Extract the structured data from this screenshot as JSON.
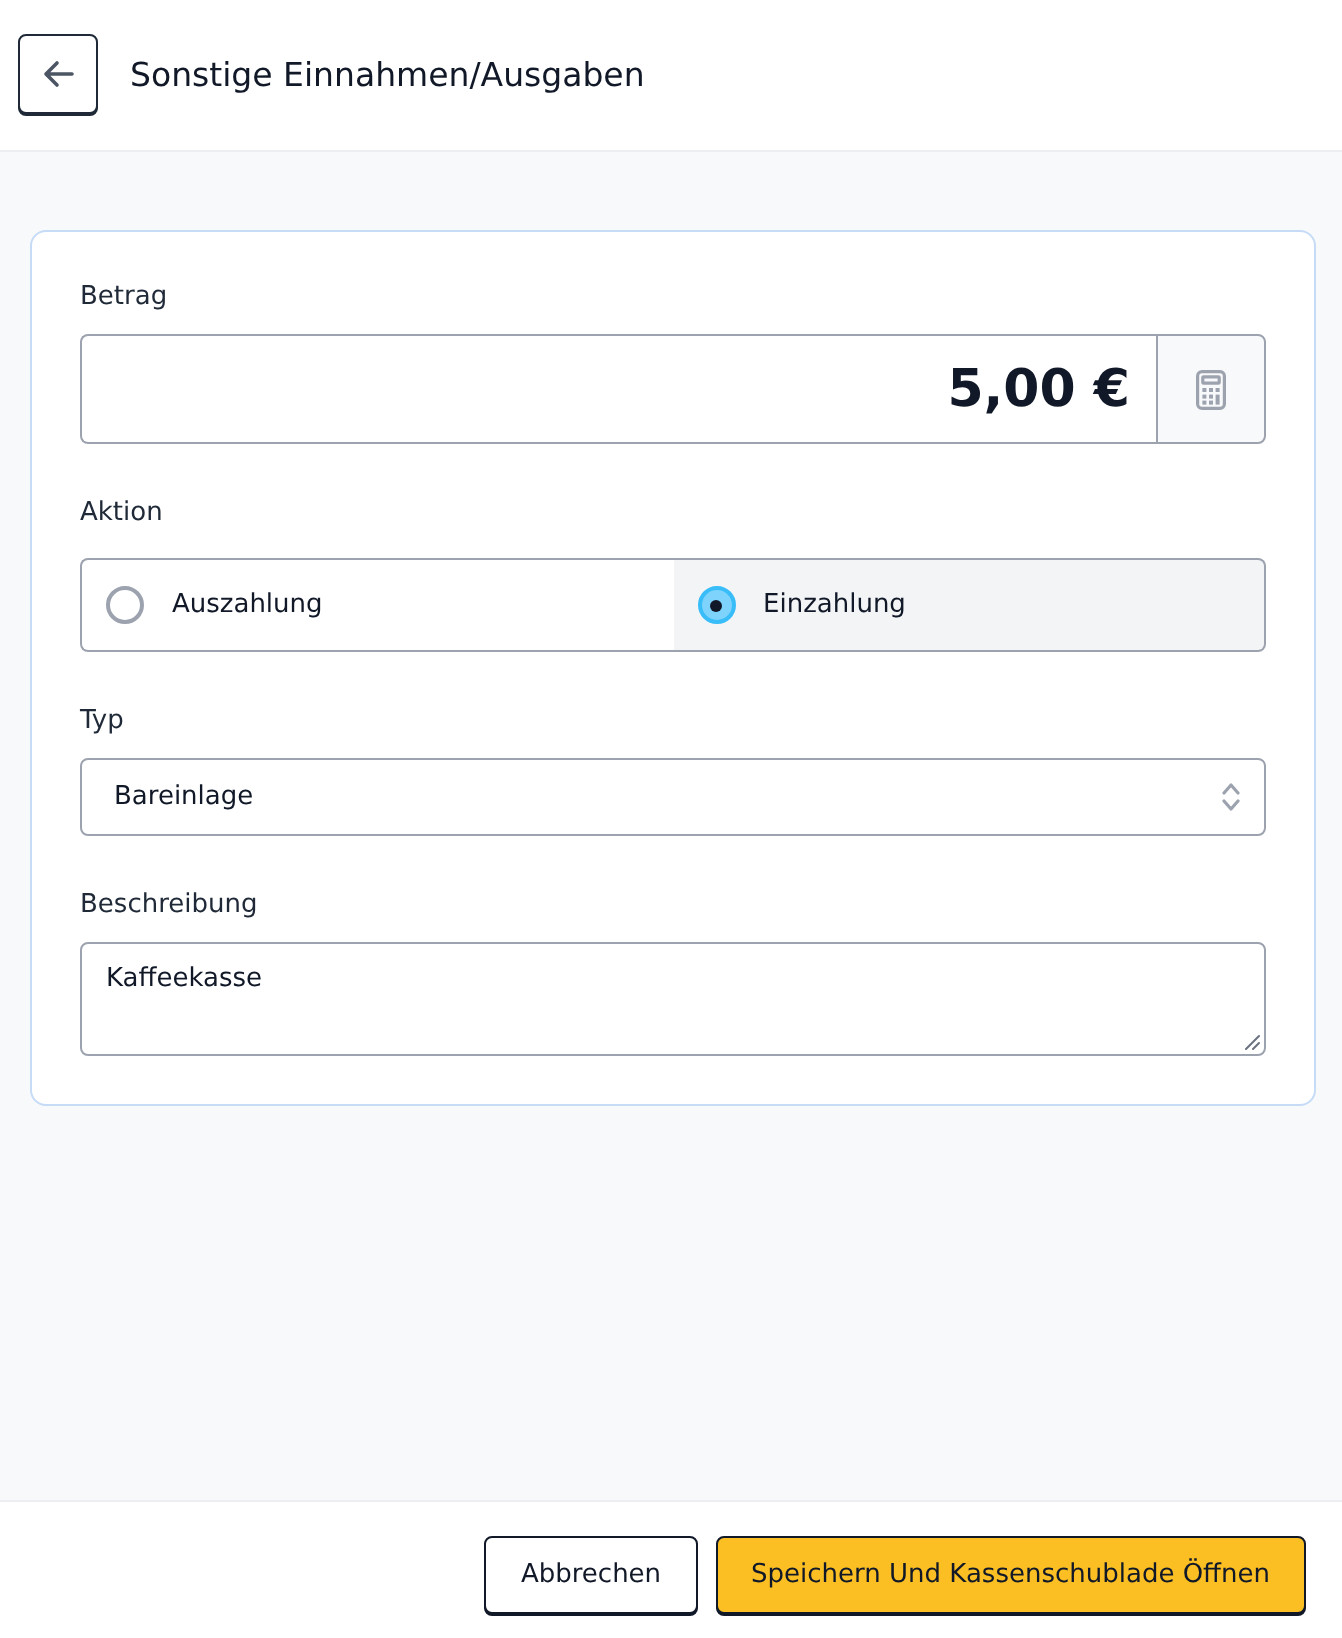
{
  "header": {
    "title": "Sonstige Einnahmen/Ausgaben"
  },
  "form": {
    "fields": [
      {
        "kind": "amount",
        "label": "Betrag",
        "value": "5,00 €"
      },
      {
        "kind": "radio",
        "label": "Aktion",
        "options": [
          {
            "label": "Auszahlung",
            "selected": false
          },
          {
            "label": "Einzahlung",
            "selected": true
          }
        ]
      },
      {
        "kind": "select",
        "label": "Typ",
        "value": "Bareinlage"
      },
      {
        "kind": "textarea",
        "label": "Beschreibung",
        "value": "Kaffeekasse"
      }
    ]
  },
  "footer": {
    "buttons": [
      {
        "label": "Abbrechen",
        "kind": "secondary"
      },
      {
        "label": "Speichern Und Kassenschublade Öffnen",
        "kind": "primary"
      }
    ]
  }
}
